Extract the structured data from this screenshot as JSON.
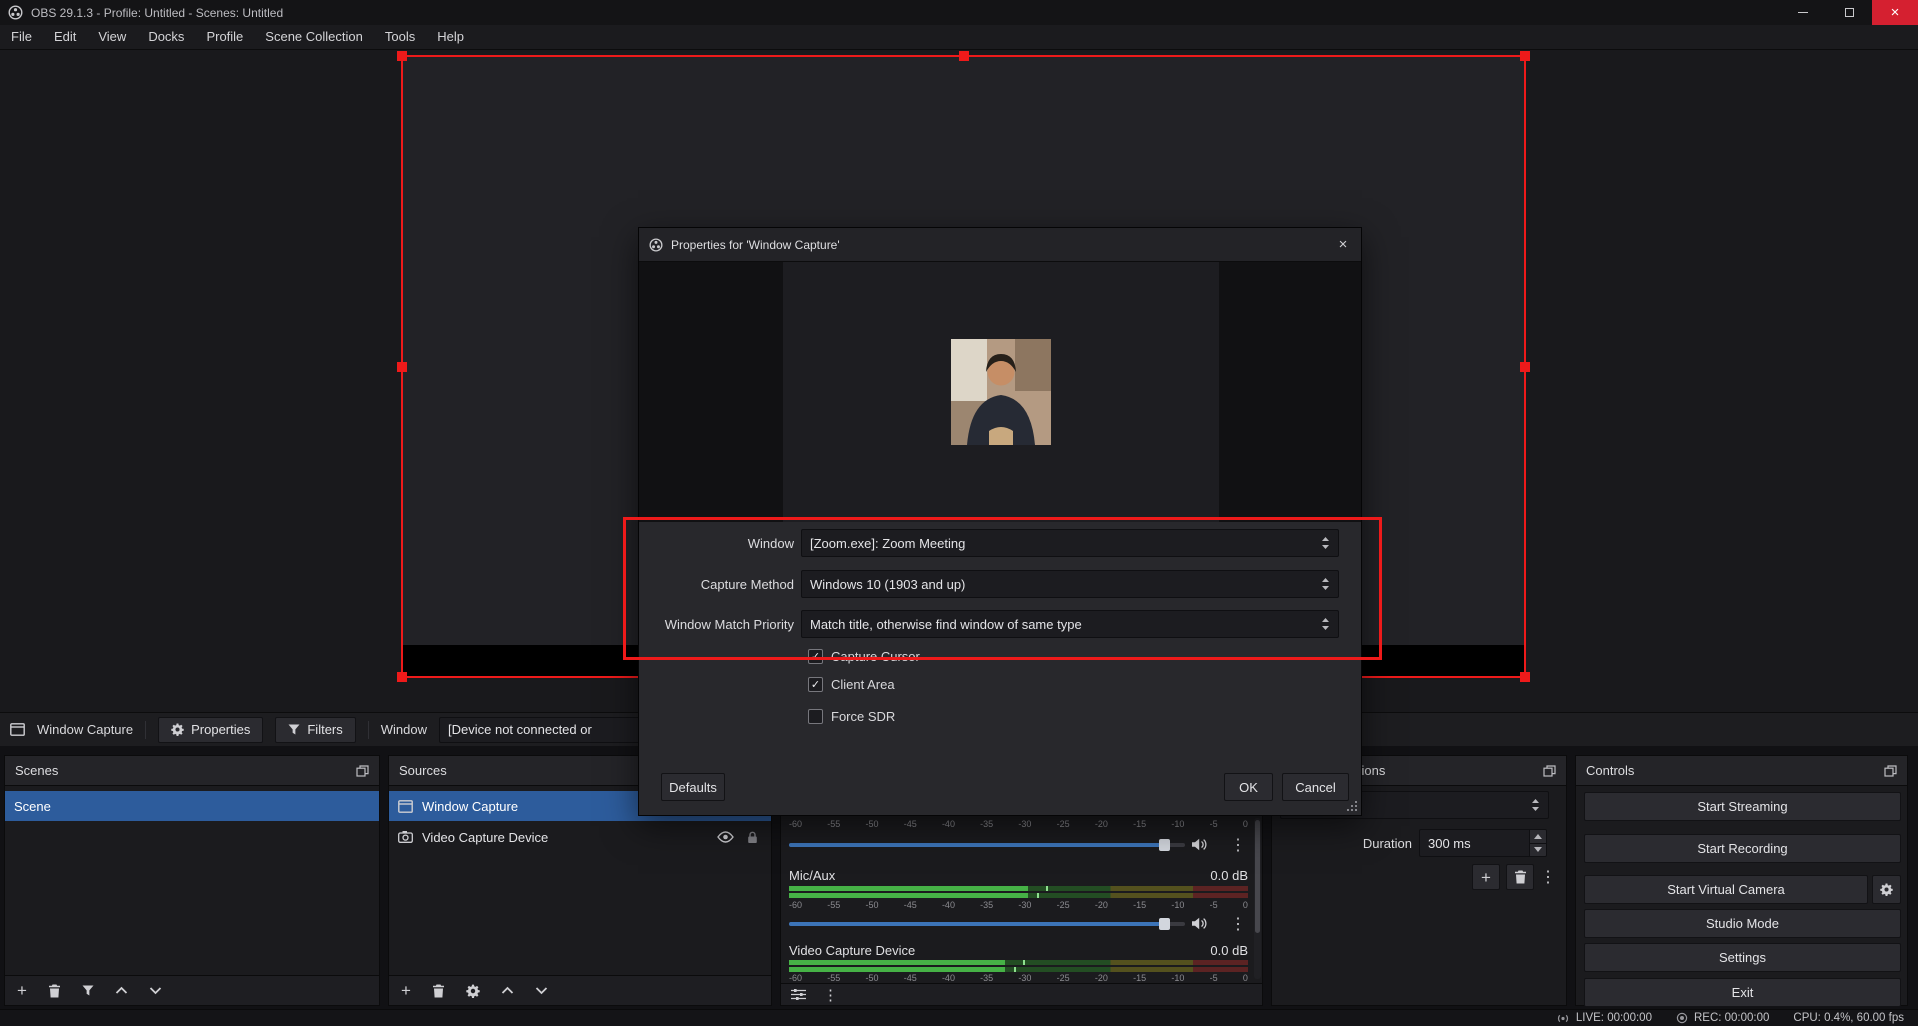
{
  "colors": {
    "accent-blue": "#2d5c9c",
    "annotation-red": "#ee1a1a",
    "close-red": "#d52030",
    "slider-blue": "#3c74b8",
    "meter-green": "#46b246",
    "meter-green-dim": "#234d23",
    "meter-yellow-dim": "#54511e",
    "meter-red-dim": "#5c2323"
  },
  "icons": {
    "plus": "+",
    "dots": "⋮",
    "close": "×",
    "check": "✓"
  },
  "title_bar": {
    "title": "OBS 29.1.3 - Profile: Untitled - Scenes: Untitled"
  },
  "menu": {
    "items": [
      "File",
      "Edit",
      "View",
      "Docks",
      "Profile",
      "Scene Collection",
      "Tools",
      "Help"
    ]
  },
  "source_toolbar": {
    "source_name": "Window Capture",
    "properties": "Properties",
    "filters": "Filters",
    "window_label": "Window",
    "window_value": "[Device not connected or"
  },
  "dialog": {
    "title": "Properties for 'Window Capture'",
    "rows": [
      {
        "label": "Window",
        "value": "[Zoom.exe]: Zoom Meeting"
      },
      {
        "label": "Capture Method",
        "value": "Windows 10 (1903 and up)"
      },
      {
        "label": "Window Match Priority",
        "value": "Match title, otherwise find window of same type"
      }
    ],
    "checkboxes": [
      {
        "label": "Capture Cursor",
        "checked": true,
        "mark": "✓"
      },
      {
        "label": "Client Area",
        "checked": true,
        "mark": "✓"
      },
      {
        "label": "Force SDR",
        "checked": false,
        "mark": ""
      }
    ],
    "defaults": "Defaults",
    "ok": "OK",
    "cancel": "Cancel"
  },
  "scenes": {
    "title": "Scenes",
    "items": [
      {
        "name": "Scene",
        "selected": true
      }
    ]
  },
  "sources": {
    "title": "Sources",
    "items": [
      {
        "name": "Window Capture",
        "selected": true
      },
      {
        "name": "Video Capture Device",
        "selected": false
      }
    ]
  },
  "mixer": {
    "ticks": [
      "-60",
      "-55",
      "-50",
      "-45",
      "-40",
      "-35",
      "-30",
      "-25",
      "-20",
      "-15",
      "-10",
      "-5",
      "0"
    ],
    "top_slider_pct": 95,
    "channels": [
      {
        "name": "Mic/Aux",
        "level": "0.0 dB",
        "meter_pct": 52,
        "slider_pct": 95
      },
      {
        "name": "Video Capture Device",
        "level": "0.0 dB",
        "meter_pct": 47
      }
    ]
  },
  "transitions": {
    "title": "Scene Transitions",
    "combo_value": "",
    "duration_label": "Duration",
    "duration_value": "300 ms"
  },
  "controls": {
    "title": "Controls",
    "buttons": [
      "Start Streaming",
      "Start Recording",
      "Start Virtual Camera",
      "Studio Mode",
      "Settings",
      "Exit"
    ]
  },
  "status": {
    "live": "LIVE: 00:00:00",
    "rec": "REC: 00:00:00",
    "cpu": "CPU: 0.4%, 60.00 fps"
  }
}
